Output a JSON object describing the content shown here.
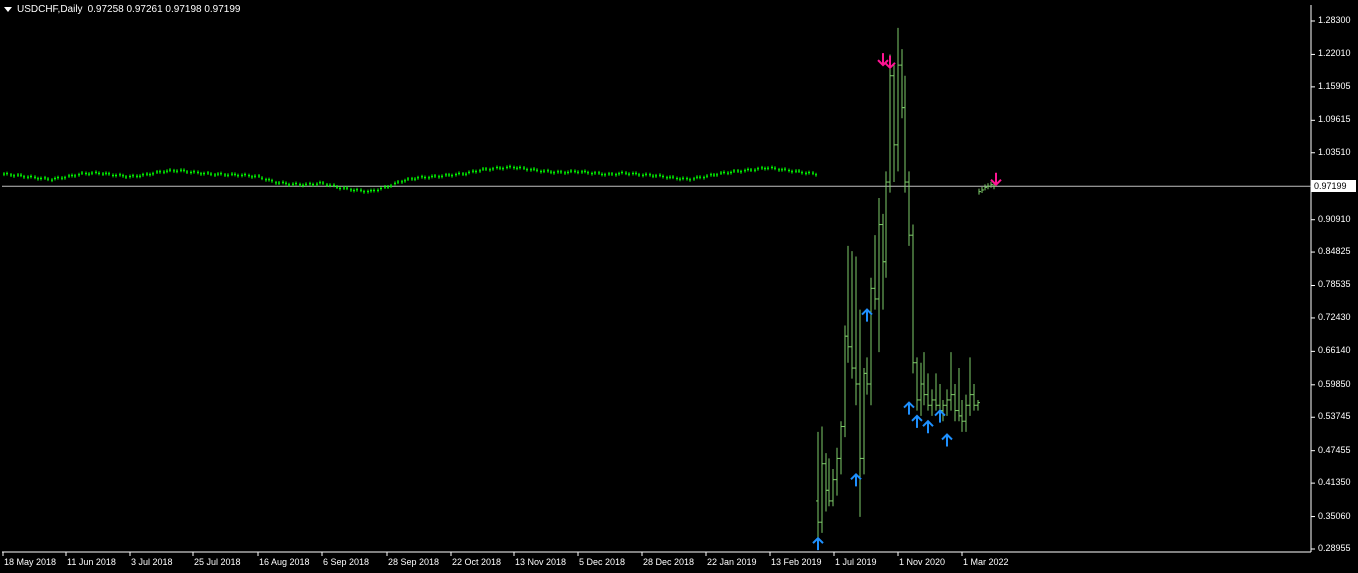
{
  "header": {
    "symbol_timeframe": "USDCHF,Daily",
    "ohlc": "0.97258 0.97261 0.97198 0.97199"
  },
  "current_price": "0.97199",
  "colors": {
    "background": "#000000",
    "bar": "#00ff00",
    "bar_pale": "#7ecc6a",
    "axis": "#ffffff",
    "price_line": "#c0c0c0",
    "up_arrow": "#1e90ff",
    "down_arrow": "#ff1493"
  },
  "icons": {
    "menu": "chart-menu-triangle-icon",
    "buy": "up-arrow-icon",
    "sell": "down-arrow-icon"
  },
  "chart_data": {
    "type": "ohlc",
    "y_ticks": [
      "1.28300",
      "1.22010",
      "1.15905",
      "1.09615",
      "1.03510",
      "0.97199",
      "0.90910",
      "0.84825",
      "0.78535",
      "0.72430",
      "0.66140",
      "0.59850",
      "0.53745",
      "0.47455",
      "0.41350",
      "0.35060",
      "0.28955"
    ],
    "ylim": [
      0.28955,
      1.283
    ],
    "x_ticks": [
      "18 May 2018",
      "11 Jun 2018",
      "3 Jul 2018",
      "25 Jul 2018",
      "16 Aug 2018",
      "6 Sep 2018",
      "28 Sep 2018",
      "22 Oct 2018",
      "13 Nov 2018",
      "5 Dec 2018",
      "28 Dec 2018",
      "22 Jan 2019",
      "13 Feb 2019",
      "1 Jul 2019",
      "1 Nov 2020",
      "1 Mar 2022"
    ],
    "current_price": 0.97199,
    "series": [
      {
        "segment": "2018 daily bars",
        "start": "18 May 2018",
        "end": "2 Mar 2019",
        "closes_sampled": [
          0.995,
          0.992,
          0.988,
          0.985,
          0.99,
          0.996,
          0.997,
          0.993,
          0.99,
          0.994,
          1.0,
          1.002,
          0.998,
          0.995,
          0.994,
          0.993,
          0.99,
          0.98,
          0.976,
          0.975,
          0.978,
          0.97,
          0.965,
          0.962,
          0.97,
          0.982,
          0.988,
          0.99,
          0.993,
          0.996,
          1.003,
          1.006,
          1.008,
          1.004,
          1.0,
          0.998,
          1.0,
          0.997,
          0.994,
          0.997,
          0.994,
          0.992,
          0.988,
          0.985,
          0.99,
          0.996,
          1.0,
          1.003,
          1.007,
          1.003,
          0.999,
          0.995
        ]
      },
      {
        "segment": "volatile bars",
        "bars": [
          {
            "o": 0.38,
            "h": 0.51,
            "l": 0.31,
            "c": 0.34
          },
          {
            "o": 0.34,
            "h": 0.52,
            "l": 0.32,
            "c": 0.45
          },
          {
            "o": 0.45,
            "h": 0.47,
            "l": 0.36,
            "c": 0.4
          },
          {
            "o": 0.4,
            "h": 0.46,
            "l": 0.37,
            "c": 0.38
          },
          {
            "o": 0.38,
            "h": 0.44,
            "l": 0.37,
            "c": 0.42
          },
          {
            "o": 0.42,
            "h": 0.48,
            "l": 0.39,
            "c": 0.46
          },
          {
            "o": 0.46,
            "h": 0.53,
            "l": 0.43,
            "c": 0.52
          },
          {
            "o": 0.52,
            "h": 0.71,
            "l": 0.5,
            "c": 0.69
          },
          {
            "o": 0.69,
            "h": 0.86,
            "l": 0.64,
            "c": 0.67
          },
          {
            "o": 0.67,
            "h": 0.85,
            "l": 0.61,
            "c": 0.63
          },
          {
            "o": 0.63,
            "h": 0.84,
            "l": 0.56,
            "c": 0.6
          },
          {
            "o": 0.6,
            "h": 0.74,
            "l": 0.35,
            "c": 0.46
          },
          {
            "o": 0.46,
            "h": 0.63,
            "l": 0.43,
            "c": 0.62
          },
          {
            "o": 0.62,
            "h": 0.65,
            "l": 0.58,
            "c": 0.6
          },
          {
            "o": 0.6,
            "h": 0.8,
            "l": 0.56,
            "c": 0.78
          },
          {
            "o": 0.78,
            "h": 0.88,
            "l": 0.74,
            "c": 0.76
          },
          {
            "o": 0.76,
            "h": 0.95,
            "l": 0.66,
            "c": 0.9
          },
          {
            "o": 0.9,
            "h": 0.92,
            "l": 0.74,
            "c": 0.83
          },
          {
            "o": 0.83,
            "h": 1.0,
            "l": 0.8,
            "c": 0.98
          },
          {
            "o": 0.98,
            "h": 1.22,
            "l": 0.96,
            "c": 1.18
          },
          {
            "o": 1.18,
            "h": 1.2,
            "l": 0.98,
            "c": 1.05
          },
          {
            "o": 1.05,
            "h": 1.27,
            "l": 1.0,
            "c": 1.2
          },
          {
            "o": 1.2,
            "h": 1.23,
            "l": 1.1,
            "c": 1.12
          },
          {
            "o": 1.12,
            "h": 1.18,
            "l": 0.96,
            "c": 0.98
          },
          {
            "o": 0.98,
            "h": 1.0,
            "l": 0.86,
            "c": 0.88
          },
          {
            "o": 0.88,
            "h": 0.9,
            "l": 0.62,
            "c": 0.64
          },
          {
            "o": 0.64,
            "h": 0.65,
            "l": 0.55,
            "c": 0.57
          },
          {
            "o": 0.57,
            "h": 0.64,
            "l": 0.54,
            "c": 0.6
          },
          {
            "o": 0.6,
            "h": 0.66,
            "l": 0.56,
            "c": 0.58
          },
          {
            "o": 0.58,
            "h": 0.62,
            "l": 0.55,
            "c": 0.56
          },
          {
            "o": 0.56,
            "h": 0.59,
            "l": 0.54,
            "c": 0.57
          },
          {
            "o": 0.57,
            "h": 0.62,
            "l": 0.55,
            "c": 0.56
          },
          {
            "o": 0.56,
            "h": 0.6,
            "l": 0.53,
            "c": 0.55
          },
          {
            "o": 0.55,
            "h": 0.57,
            "l": 0.53,
            "c": 0.56
          },
          {
            "o": 0.56,
            "h": 0.59,
            "l": 0.54,
            "c": 0.57
          },
          {
            "o": 0.57,
            "h": 0.66,
            "l": 0.55,
            "c": 0.58
          },
          {
            "o": 0.58,
            "h": 0.6,
            "l": 0.53,
            "c": 0.55
          },
          {
            "o": 0.55,
            "h": 0.63,
            "l": 0.53,
            "c": 0.54
          },
          {
            "o": 0.54,
            "h": 0.57,
            "l": 0.51,
            "c": 0.53
          },
          {
            "o": 0.53,
            "h": 0.58,
            "l": 0.51,
            "c": 0.56
          },
          {
            "o": 0.56,
            "h": 0.65,
            "l": 0.54,
            "c": 0.58
          },
          {
            "o": 0.58,
            "h": 0.6,
            "l": 0.55,
            "c": 0.56
          },
          {
            "o": 0.56,
            "h": 0.57,
            "l": 0.55,
            "c": 0.565
          }
        ]
      },
      {
        "segment": "latest bars",
        "closes": [
          0.962,
          0.965,
          0.97,
          0.972,
          0.975,
          0.972
        ]
      }
    ],
    "signals": [
      {
        "type": "buy",
        "bar": 0,
        "price": 0.31
      },
      {
        "type": "buy",
        "bar": 10,
        "price": 0.43
      },
      {
        "type": "buy",
        "bar": 13,
        "price": 0.74
      },
      {
        "type": "sell",
        "bar": 17,
        "price": 1.2
      },
      {
        "type": "sell",
        "bar": 19,
        "price": 1.195
      },
      {
        "type": "buy",
        "bar": 24,
        "price": 0.565
      },
      {
        "type": "buy",
        "bar": 26,
        "price": 0.54
      },
      {
        "type": "buy",
        "bar": 29,
        "price": 0.53
      },
      {
        "type": "buy",
        "bar": 32,
        "price": 0.55
      },
      {
        "type": "buy",
        "bar": 34,
        "price": 0.505
      },
      {
        "type": "sell",
        "latest": 3,
        "price": 0.975
      }
    ]
  }
}
